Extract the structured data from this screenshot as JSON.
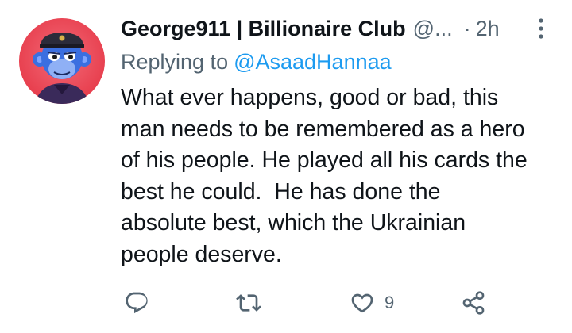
{
  "tweet": {
    "display_name": "George911 | Billionaire Club",
    "handle": "@...",
    "separator": "·",
    "time": "2h",
    "replying_label": "Replying to",
    "replying_to": "@AsaadHannaa",
    "text_lines": [
      "What ever happens, good or bad, this",
      "man needs to be remembered as a hero",
      "of his people. He played all his cards the",
      "best he could.  He has done the",
      "absolute best, which the Ukrainian",
      "people deserve."
    ],
    "like_count": "9"
  },
  "icons": {
    "avatar": "ape-avatar-icon",
    "more": "more-vertical-icon",
    "reply": "reply-icon",
    "retweet": "retweet-icon",
    "like": "heart-icon",
    "share": "share-icon"
  },
  "colors": {
    "text": "#0f1419",
    "secondary": "#536471",
    "link": "#1d9bf0",
    "avatar_bg": "#e8404f"
  }
}
